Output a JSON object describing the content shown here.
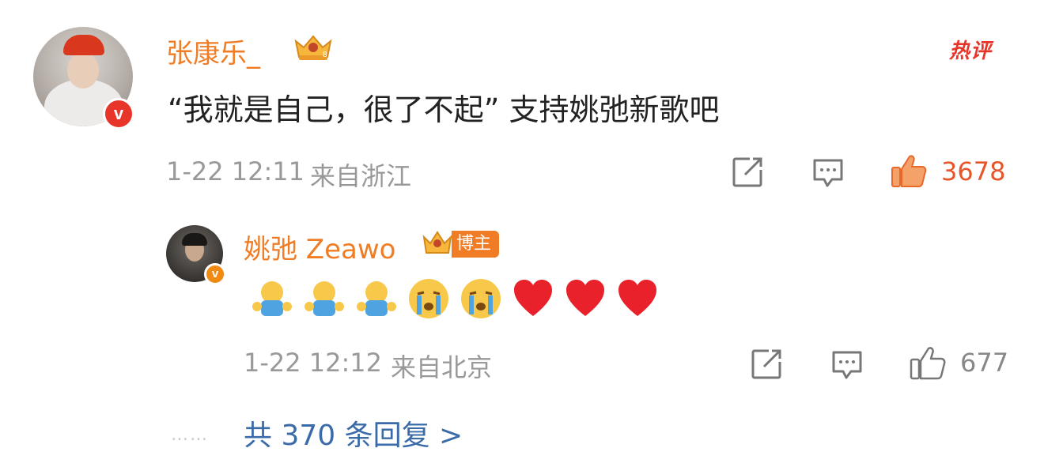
{
  "comment": {
    "username": "张康乐_",
    "hot_label": "热评",
    "text": "“我就是自己，很了不起” 支持姚弛新歌吧",
    "time": "1-22 12:11",
    "location": "来自浙江",
    "like_count": "3678"
  },
  "reply": {
    "username": "姚弛 Zeawo",
    "owner_tag": "博主",
    "emojis": [
      "hug-icon",
      "hug-icon",
      "hug-icon",
      "crying-icon",
      "crying-icon",
      "heart-icon",
      "heart-icon",
      "heart-icon"
    ],
    "time": "1-22 12:12",
    "location": "来自北京",
    "like_count": "677"
  },
  "more_replies": {
    "dots": "……",
    "label": "共 370 条回复 >"
  },
  "colors": {
    "username": "#f07d25",
    "hot": "#e8352a",
    "link": "#3a6ba8",
    "meta": "#999999"
  }
}
